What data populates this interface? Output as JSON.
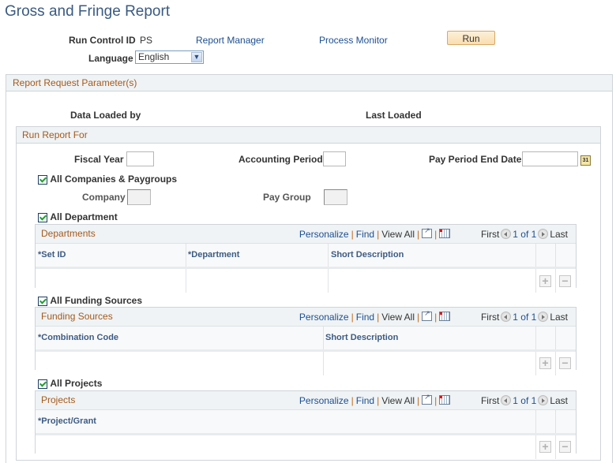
{
  "page": {
    "title": "Gross and Fringe Report"
  },
  "header": {
    "run_control_label": "Run Control ID",
    "run_control_value": "PS",
    "report_manager_link": "Report Manager",
    "process_monitor_link": "Process Monitor",
    "run_button": "Run",
    "language_label": "Language",
    "language_value": "English"
  },
  "params": {
    "section_title": "Report Request Parameter(s)",
    "data_loaded_by_label": "Data Loaded by",
    "last_loaded_label": "Last Loaded",
    "run_report_for": {
      "title": "Run Report For",
      "fiscal_year_label": "Fiscal Year",
      "fiscal_year_value": "",
      "accounting_period_label": "Accounting Period",
      "accounting_period_value": "",
      "pay_period_end_label": "Pay Period End Date",
      "pay_period_end_value": "",
      "calendar_icon_text": "31",
      "all_companies_label": "All Companies & Paygroups",
      "all_companies_checked": true,
      "company_label": "Company",
      "company_value": "",
      "pay_group_label": "Pay Group",
      "pay_group_value": "",
      "all_department_label": "All Department",
      "all_department_checked": true,
      "all_funding_label": "All Funding Sources",
      "all_funding_checked": true,
      "all_projects_label": "All Projects",
      "all_projects_checked": true
    }
  },
  "grid_nav": {
    "personalize": "Personalize",
    "find": "Find",
    "view_all": "View All",
    "first": "First",
    "count": "1 of 1",
    "last": "Last"
  },
  "grids": {
    "departments": {
      "title": "Departments",
      "columns": [
        "*Set ID",
        "*Department",
        "Short Description"
      ],
      "rows": [
        [
          "",
          "",
          ""
        ]
      ]
    },
    "funding": {
      "title": "Funding Sources",
      "columns": [
        "*Combination Code",
        "Short Description"
      ],
      "rows": [
        [
          "",
          ""
        ]
      ]
    },
    "projects": {
      "title": "Projects",
      "columns": [
        "*Project/Grant"
      ],
      "rows": [
        [
          ""
        ]
      ]
    }
  },
  "icons": {
    "add": "+",
    "delete": "−",
    "dropdown": "⌄"
  }
}
